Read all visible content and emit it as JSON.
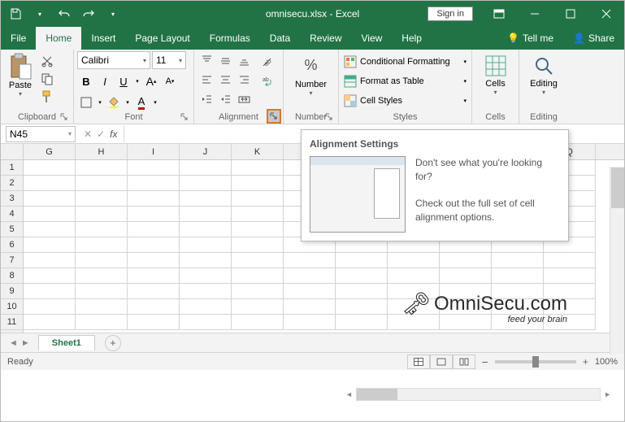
{
  "titlebar": {
    "filename": "omnisecu.xlsx - Excel",
    "signin": "Sign in"
  },
  "menu": {
    "file": "File",
    "home": "Home",
    "insert": "Insert",
    "pageLayout": "Page Layout",
    "formulas": "Formulas",
    "data": "Data",
    "review": "Review",
    "view": "View",
    "help": "Help",
    "tellme": "Tell me",
    "share": "Share"
  },
  "ribbon": {
    "clipboard": {
      "label": "Clipboard",
      "paste": "Paste"
    },
    "font": {
      "label": "Font",
      "name": "Calibri",
      "size": "11"
    },
    "alignment": {
      "label": "Alignment"
    },
    "number": {
      "label": "Number",
      "btn": "Number"
    },
    "styles": {
      "label": "Styles",
      "cond": "Conditional Formatting",
      "table": "Format as Table",
      "cell": "Cell Styles"
    },
    "cells": {
      "label": "Cells",
      "btn": "Cells"
    },
    "editing": {
      "label": "Editing",
      "btn": "Editing"
    }
  },
  "formula": {
    "namebox": "N45"
  },
  "columns": [
    "G",
    "H",
    "I",
    "J",
    "K",
    "",
    "",
    "",
    "",
    "",
    "",
    "Q"
  ],
  "rows": [
    "1",
    "2",
    "3",
    "4",
    "5",
    "6",
    "7",
    "8",
    "9",
    "10",
    "11"
  ],
  "sheets": {
    "active": "Sheet1"
  },
  "status": {
    "ready": "Ready",
    "zoom": "100%"
  },
  "tooltip": {
    "title": "Alignment Settings",
    "l1": "Don't see what you're looking for?",
    "l2": "Check out the full set of cell alignment options."
  },
  "watermark": {
    "text": "OmniSecu.com",
    "sub": "feed your brain"
  }
}
